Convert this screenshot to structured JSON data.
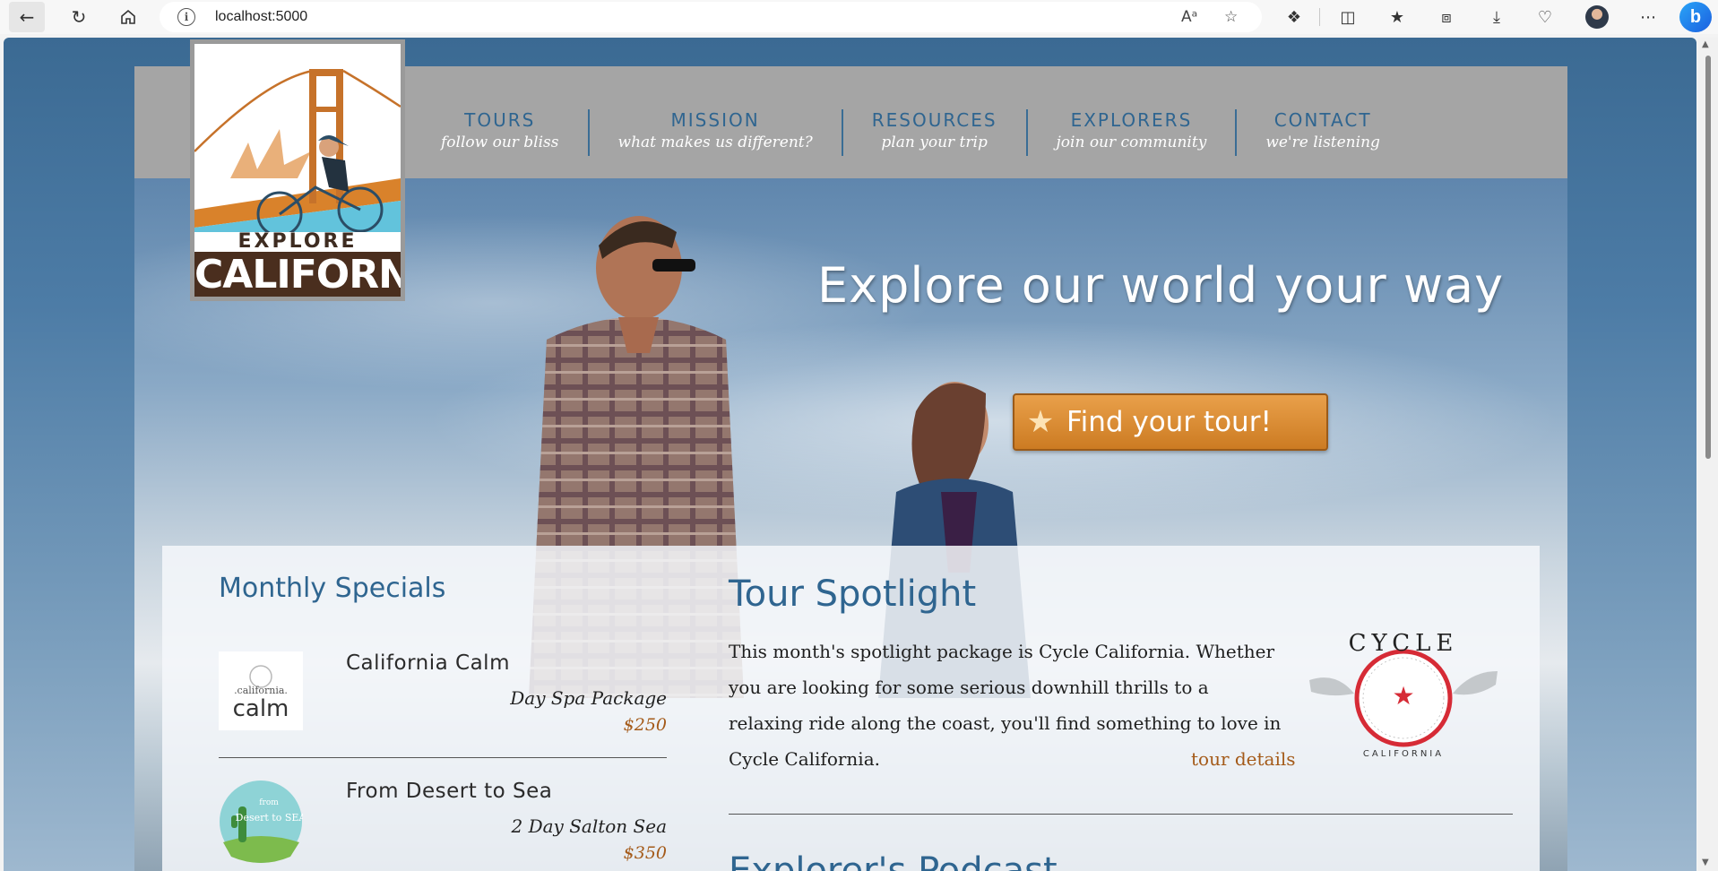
{
  "browser": {
    "url": "localhost:5000",
    "read_aloud_label": "Aᵃ"
  },
  "site": {
    "logo": {
      "explore": "EXPLORE",
      "california": "CALIFORNIA"
    },
    "nav": [
      {
        "title": "TOURS",
        "sub": "follow our bliss"
      },
      {
        "title": "MISSION",
        "sub": "what makes us different?"
      },
      {
        "title": "RESOURCES",
        "sub": "plan your trip"
      },
      {
        "title": "EXPLORERS",
        "sub": "join our community"
      },
      {
        "title": "CONTACT",
        "sub": "we're listening"
      }
    ],
    "hero": {
      "title": "Explore our world your way",
      "cta": "Find your tour!"
    },
    "specials": {
      "title": "Monthly Specials",
      "items": [
        {
          "name": "California Calm",
          "package": "Day Spa Package",
          "price": "$250",
          "thumb_text_top": ".california.",
          "thumb_text_main": "calm"
        },
        {
          "name": "From Desert to Sea",
          "package": "2 Day Salton Sea",
          "price": "$350",
          "thumb_text_top": "from",
          "thumb_text_main": "Desert to SEA"
        }
      ]
    },
    "spotlight": {
      "title": "Tour Spotlight",
      "body": "This month's spotlight package is Cycle California. Whether you are looking for some serious downhill thrills to a relaxing ride along the coast, you'll find something to love in Cycle California.",
      "link": "tour details",
      "logo_top": "CYCLE",
      "logo_bottom": "CALIFORNIA"
    },
    "podcast": {
      "title": "Explorer's Podcast"
    }
  }
}
